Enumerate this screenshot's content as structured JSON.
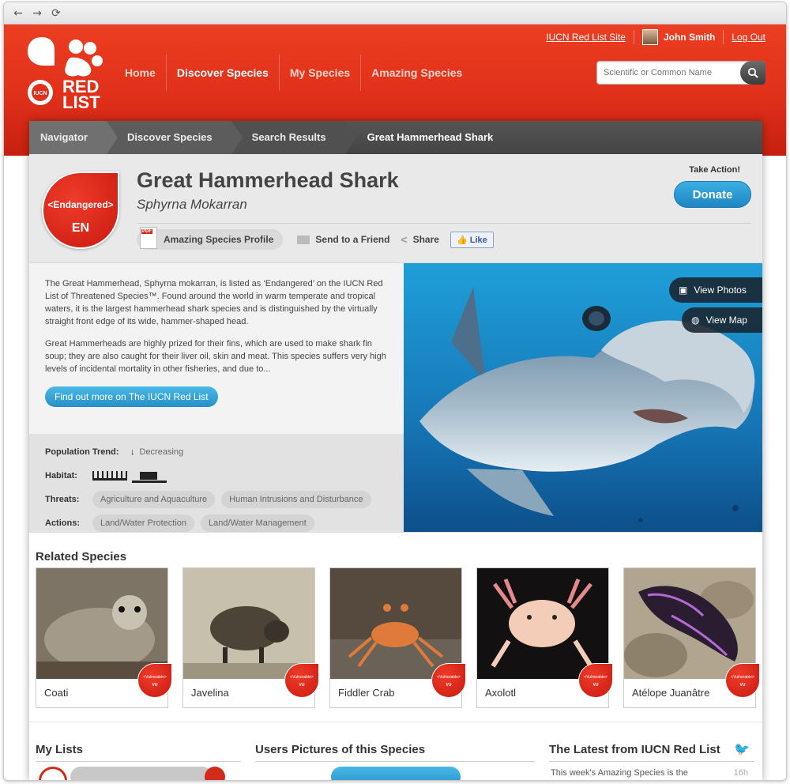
{
  "browser": {
    "back": "←",
    "forward": "→",
    "reload": "⟳"
  },
  "header": {
    "logo_text": [
      "RED",
      "LIST"
    ],
    "logo_badge": "IUCN",
    "nav": [
      "Home",
      "Discover Species",
      "My Species",
      "Amazing Species"
    ],
    "site_link": "IUCN Red List Site",
    "user_name": "John Smith",
    "logout": "Log Out",
    "search_placeholder": "Scientific or Common Name"
  },
  "breadcrumb": [
    "Navigator",
    "Discover Species",
    "Search Results",
    "Great Hammerhead Shark"
  ],
  "species": {
    "status": "<Endangered>",
    "status_code": "EN",
    "common_name": "Great Hammerhead Shark",
    "scientific_name": "Sphyrna Mokarran",
    "take_action": "Take Action!",
    "donate": "Donate",
    "profile": "Amazing Species Profile",
    "send": "Send to a Friend",
    "share": "Share",
    "like": "Like",
    "description": [
      "The Great Hammerhead, Sphyrna mokarran, is listed as ‘Endangered’ on the IUCN Red List of Threatened Species™. Found around the world in warm temperate and tropical waters, it is the largest hammerhead shark species and is distinguished by the virtually straight front edge of its wide, hammer-shaped head.",
      "Great Hammerheads are highly prized for their fins, which are used to make shark fin soup; they are also caught for their liver oil, skin and meat. This species suffers very high levels of incidental mortality in other fisheries, and due to..."
    ],
    "find_out": "Find out more on The IUCN Red List",
    "population_label": "Population Trend:",
    "population_value": "Decreasing",
    "habitat_label": "Habitat:",
    "threats_label": "Threats:",
    "threats": [
      "Agriculture and Aquaculture",
      "Human Intrusions and Disturbance"
    ],
    "actions_label": "Actions:",
    "actions": [
      "Land/Water Protection",
      "Land/Water Management"
    ],
    "view_photos": "View Photos",
    "view_map": "View Map"
  },
  "related": {
    "title": "Related Species",
    "items": [
      {
        "name": "Coati",
        "status": "<Vulnerable>",
        "code": "VU"
      },
      {
        "name": "Javelina",
        "status": "<Vulnerable>",
        "code": "VU"
      },
      {
        "name": "Fiddler Crab",
        "status": "<Vulnerable>",
        "code": "VU"
      },
      {
        "name": "Axolotl",
        "status": "<Vulnerable>",
        "code": "VU"
      },
      {
        "name": "Atélope Juanâtre",
        "status": "<Vulnerable>",
        "code": "VU"
      }
    ]
  },
  "bottom": {
    "my_lists": "My Lists",
    "user_pictures": "Users Pictures of this Species",
    "latest": "The Latest from IUCN Red List",
    "tweet": "This week's Amazing Species is the",
    "tweet_time": "16h"
  }
}
